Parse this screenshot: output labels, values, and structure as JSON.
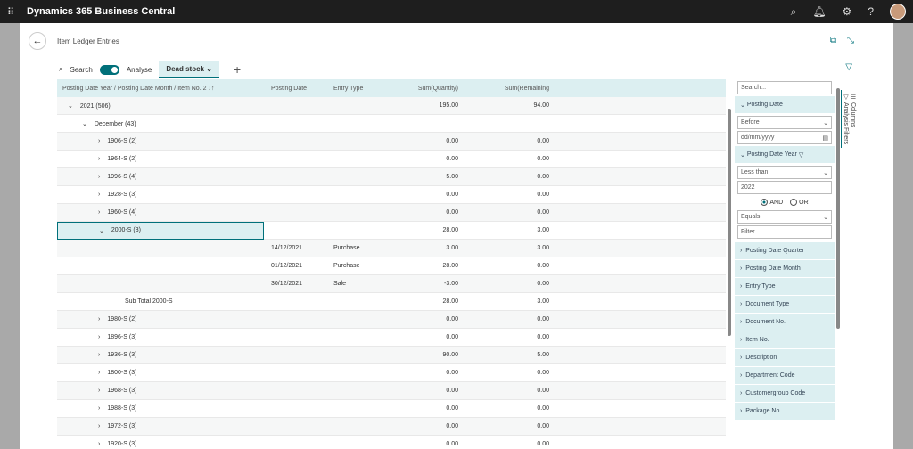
{
  "app": {
    "title": "Dynamics 365 Business Central"
  },
  "page": {
    "title": "Item Ledger Entries"
  },
  "toolbar": {
    "search": "Search",
    "analyse": "Analyse",
    "tab": "Dead stock"
  },
  "columns": [
    "Posting Date Year / Posting Date Month / Item No. 2 ↓↑",
    "Posting Date",
    "Entry Type",
    "Sum(Quantity)",
    "Sum(Remaining"
  ],
  "rows": [
    {
      "level": 0,
      "exp": "v",
      "label": "2021 (506)",
      "date": "",
      "type": "",
      "qty": "195.00",
      "rem": "94.00"
    },
    {
      "level": 1,
      "exp": "v",
      "label": "December (43)",
      "date": "",
      "type": "",
      "qty": "",
      "rem": ""
    },
    {
      "level": 2,
      "exp": ">",
      "label": "1906-S (2)",
      "date": "",
      "type": "",
      "qty": "0.00",
      "rem": "0.00"
    },
    {
      "level": 2,
      "exp": ">",
      "label": "1964-S (2)",
      "date": "",
      "type": "",
      "qty": "0.00",
      "rem": "0.00"
    },
    {
      "level": 2,
      "exp": ">",
      "label": "1996-S (4)",
      "date": "",
      "type": "",
      "qty": "5.00",
      "rem": "0.00"
    },
    {
      "level": 2,
      "exp": ">",
      "label": "1928-S (3)",
      "date": "",
      "type": "",
      "qty": "0.00",
      "rem": "0.00"
    },
    {
      "level": 2,
      "exp": ">",
      "label": "1960-S (4)",
      "date": "",
      "type": "",
      "qty": "0.00",
      "rem": "0.00"
    },
    {
      "level": 2,
      "exp": "v",
      "label": "2000-S (3)",
      "date": "",
      "type": "",
      "qty": "28.00",
      "rem": "3.00",
      "selected": true
    },
    {
      "level": 3,
      "exp": "",
      "label": "",
      "date": "14/12/2021",
      "type": "Purchase",
      "qty": "3.00",
      "rem": "3.00"
    },
    {
      "level": 3,
      "exp": "",
      "label": "",
      "date": "01/12/2021",
      "type": "Purchase",
      "qty": "28.00",
      "rem": "0.00"
    },
    {
      "level": 3,
      "exp": "",
      "label": "",
      "date": "30/12/2021",
      "type": "Sale",
      "qty": "-3.00",
      "rem": "0.00"
    },
    {
      "level": 3,
      "exp": "",
      "label": "Sub Total 2000-S",
      "date": "",
      "type": "",
      "qty": "28.00",
      "rem": "3.00"
    },
    {
      "level": 2,
      "exp": ">",
      "label": "1980-S (2)",
      "date": "",
      "type": "",
      "qty": "0.00",
      "rem": "0.00"
    },
    {
      "level": 2,
      "exp": ">",
      "label": "1896-S (3)",
      "date": "",
      "type": "",
      "qty": "0.00",
      "rem": "0.00"
    },
    {
      "level": 2,
      "exp": ">",
      "label": "1936-S (3)",
      "date": "",
      "type": "",
      "qty": "90.00",
      "rem": "5.00"
    },
    {
      "level": 2,
      "exp": ">",
      "label": "1800-S (3)",
      "date": "",
      "type": "",
      "qty": "0.00",
      "rem": "0.00"
    },
    {
      "level": 2,
      "exp": ">",
      "label": "1968-S (3)",
      "date": "",
      "type": "",
      "qty": "0.00",
      "rem": "0.00"
    },
    {
      "level": 2,
      "exp": ">",
      "label": "1988-S (3)",
      "date": "",
      "type": "",
      "qty": "0.00",
      "rem": "0.00"
    },
    {
      "level": 2,
      "exp": ">",
      "label": "1972-S (3)",
      "date": "",
      "type": "",
      "qty": "0.00",
      "rem": "0.00"
    },
    {
      "level": 2,
      "exp": ">",
      "label": "1920-S (3)",
      "date": "",
      "type": "",
      "qty": "0.00",
      "rem": "0.00"
    }
  ],
  "filters": {
    "search_placeholder": "Search...",
    "posting_date": {
      "label": "Posting Date",
      "op": "Before",
      "placeholder": "dd/mm/yyyy"
    },
    "posting_date_year": {
      "label": "Posting Date Year",
      "op": "Less than",
      "value": "2022",
      "and": "AND",
      "or": "OR",
      "op2": "Equals",
      "placeholder": "Filter..."
    },
    "collapsed": [
      "Posting Date Quarter",
      "Posting Date Month",
      "Entry Type",
      "Document Type",
      "Document No.",
      "Item No.",
      "Description",
      "Department Code",
      "Customergroup Code",
      "Package No."
    ]
  },
  "side_tabs": {
    "columns": "Columns",
    "analysis": "Analysis Filters"
  }
}
